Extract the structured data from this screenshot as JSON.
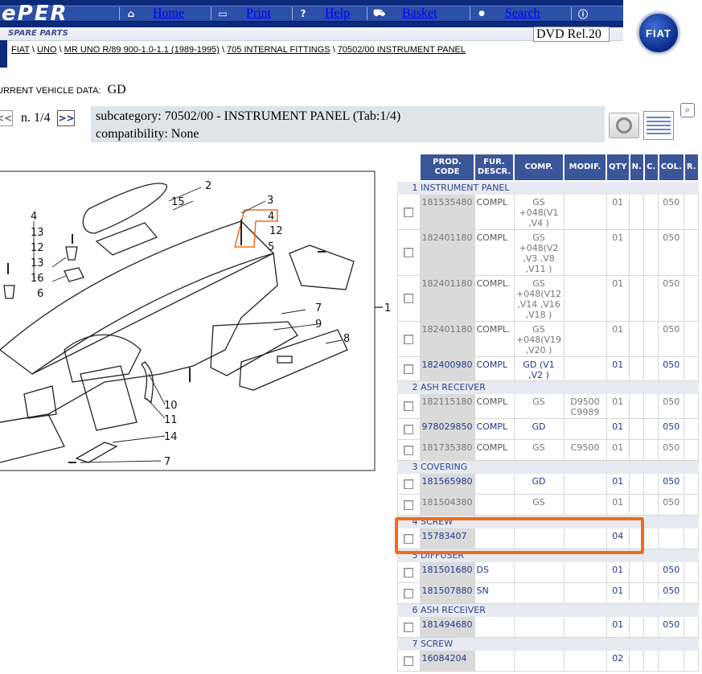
{
  "app": {
    "logo": "ePER",
    "section": "SPARE PARTS",
    "dvd": "DVD Rel.20",
    "brand": "FIAT"
  },
  "nav": [
    {
      "icon": "⌂",
      "label": "Home"
    },
    {
      "icon": "▭",
      "label": "Print"
    },
    {
      "icon": "?",
      "label": "Help"
    },
    {
      "icon": "⛟",
      "label": "Basket"
    },
    {
      "icon": "●",
      "label": "Search"
    },
    {
      "icon": "ⓘ",
      "label": ""
    }
  ],
  "breadcrumb": {
    "items": [
      "FIAT",
      "UNO",
      "MR UNO R/89 900-1.0-1.1 (1989-1995)",
      "705 INTERNAL FITTINGS",
      "70502/00 INSTRUMENT PANEL"
    ],
    "sep": "\\"
  },
  "vehicle": {
    "label": "URRENT VEHICLE DATA:",
    "value": "GD"
  },
  "pager": {
    "prev": "<<",
    "label": "n. 1/4",
    "next": ">>"
  },
  "subcategory": {
    "label": "subcategory:",
    "value": "70502/00 - INSTRUMENT PANEL (Tab:1/4)",
    "compat_label": "compatibility:",
    "compat_value": "None"
  },
  "diagram": {
    "callouts": [
      "2",
      "15",
      "3",
      "4",
      "12",
      "5",
      "4",
      "13",
      "12",
      "13",
      "16",
      "6",
      "7",
      "9",
      "8",
      "10",
      "11",
      "14",
      "7",
      "1"
    ]
  },
  "table": {
    "headers": [
      "PROD. CODE",
      "FUR. DESCR.",
      "COMP.",
      "MODIF.",
      "QTY",
      "N.",
      "C.",
      "COL.",
      "R."
    ],
    "groups": [
      {
        "title": "1  INSTRUMENT PANEL",
        "rows": [
          {
            "code": "181535480",
            "fur": "COMPL",
            "comp": "GS +048(V1 ,V4 )",
            "modif": "",
            "qty": "01",
            "col": "050",
            "hl": false
          },
          {
            "code": "182401180",
            "fur": "COMPL",
            "comp": "GS +048(V2 ,V3 ,V8 ,V11 )",
            "modif": "",
            "qty": "01",
            "col": "050",
            "hl": false
          },
          {
            "code": "182401180",
            "fur": "COMPL.",
            "comp": "GS +048(V12 ,V14 ,V16 ,V18 )",
            "modif": "",
            "qty": "01",
            "col": "050",
            "hl": false
          },
          {
            "code": "182401180",
            "fur": "COMPL.",
            "comp": "GS +048(V19 ,V20 )",
            "modif": "",
            "qty": "01",
            "col": "050",
            "hl": false
          },
          {
            "code": "182400980",
            "fur": "COMPL",
            "comp": "GD (V1 ,V2 )",
            "modif": "",
            "qty": "01",
            "col": "050",
            "hl": true
          }
        ]
      },
      {
        "title": "2  ASH RECEIVER",
        "rows": [
          {
            "code": "182115180",
            "fur": "COMPL",
            "comp": "GS",
            "modif": "D9500 C9989",
            "qty": "01",
            "col": "050",
            "hl": false
          },
          {
            "code": "978029850",
            "fur": "COMPL",
            "comp": "GD",
            "modif": "",
            "qty": "01",
            "col": "050",
            "hl": true
          },
          {
            "code": "181735380",
            "fur": "COMPL",
            "comp": "GS",
            "modif": "C9500",
            "qty": "01",
            "col": "050",
            "hl": false
          }
        ]
      },
      {
        "title": "3  COVERING",
        "rows": [
          {
            "code": "181565980",
            "fur": "",
            "comp": "GD",
            "modif": "",
            "qty": "01",
            "col": "050",
            "hl": true
          },
          {
            "code": "181504380",
            "fur": "",
            "comp": "GS",
            "modif": "",
            "qty": "01",
            "col": "050",
            "hl": false
          }
        ]
      },
      {
        "title": "4  SCREW",
        "rows": [
          {
            "code": "15783407",
            "fur": "",
            "comp": "",
            "modif": "",
            "qty": "04",
            "col": "",
            "hl": true
          }
        ]
      },
      {
        "title": "5  DIFFUSER",
        "rows": [
          {
            "code": "181501680",
            "fur": "DS",
            "comp": "",
            "modif": "",
            "qty": "01",
            "col": "050",
            "hl": true
          },
          {
            "code": "181507880",
            "fur": "SN",
            "comp": "",
            "modif": "",
            "qty": "01",
            "col": "050",
            "hl": true
          }
        ]
      },
      {
        "title": "6  ASH RECEIVER",
        "rows": [
          {
            "code": "181494680",
            "fur": "",
            "comp": "",
            "modif": "",
            "qty": "01",
            "col": "050",
            "hl": true
          }
        ]
      },
      {
        "title": "7  SCREW",
        "rows": [
          {
            "code": "16084204",
            "fur": "",
            "comp": "",
            "modif": "",
            "qty": "02",
            "col": "",
            "hl": true
          }
        ]
      }
    ]
  },
  "colors": {
    "nav_bg": "#0b2a7a",
    "header_bg": "#3b5599",
    "highlight": "#f26b1b",
    "code_link": "#1f3a8a"
  }
}
